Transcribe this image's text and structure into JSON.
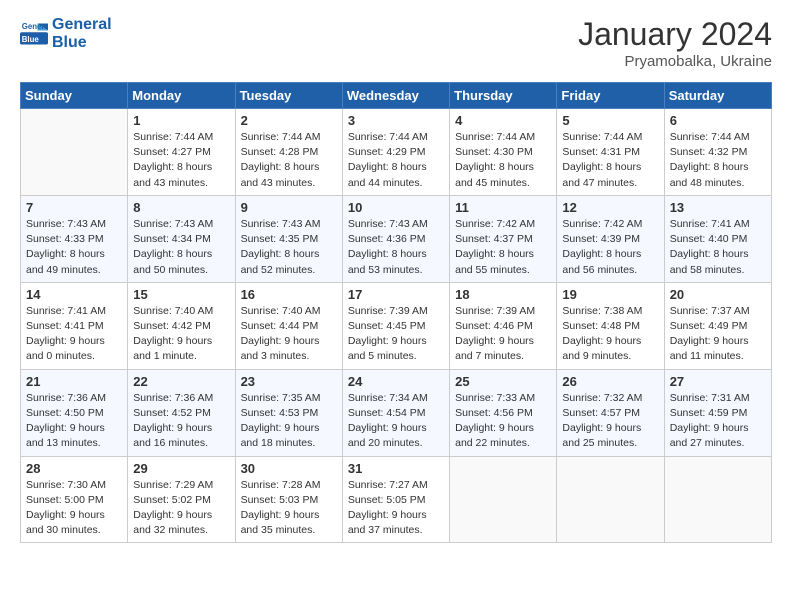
{
  "logo": {
    "line1": "General",
    "line2": "Blue"
  },
  "title": "January 2024",
  "location": "Pryamobalka, Ukraine",
  "days_of_week": [
    "Sunday",
    "Monday",
    "Tuesday",
    "Wednesday",
    "Thursday",
    "Friday",
    "Saturday"
  ],
  "weeks": [
    [
      {
        "day": "",
        "info": ""
      },
      {
        "day": "1",
        "info": "Sunrise: 7:44 AM\nSunset: 4:27 PM\nDaylight: 8 hours\nand 43 minutes."
      },
      {
        "day": "2",
        "info": "Sunrise: 7:44 AM\nSunset: 4:28 PM\nDaylight: 8 hours\nand 43 minutes."
      },
      {
        "day": "3",
        "info": "Sunrise: 7:44 AM\nSunset: 4:29 PM\nDaylight: 8 hours\nand 44 minutes."
      },
      {
        "day": "4",
        "info": "Sunrise: 7:44 AM\nSunset: 4:30 PM\nDaylight: 8 hours\nand 45 minutes."
      },
      {
        "day": "5",
        "info": "Sunrise: 7:44 AM\nSunset: 4:31 PM\nDaylight: 8 hours\nand 47 minutes."
      },
      {
        "day": "6",
        "info": "Sunrise: 7:44 AM\nSunset: 4:32 PM\nDaylight: 8 hours\nand 48 minutes."
      }
    ],
    [
      {
        "day": "7",
        "info": "Sunrise: 7:43 AM\nSunset: 4:33 PM\nDaylight: 8 hours\nand 49 minutes."
      },
      {
        "day": "8",
        "info": "Sunrise: 7:43 AM\nSunset: 4:34 PM\nDaylight: 8 hours\nand 50 minutes."
      },
      {
        "day": "9",
        "info": "Sunrise: 7:43 AM\nSunset: 4:35 PM\nDaylight: 8 hours\nand 52 minutes."
      },
      {
        "day": "10",
        "info": "Sunrise: 7:43 AM\nSunset: 4:36 PM\nDaylight: 8 hours\nand 53 minutes."
      },
      {
        "day": "11",
        "info": "Sunrise: 7:42 AM\nSunset: 4:37 PM\nDaylight: 8 hours\nand 55 minutes."
      },
      {
        "day": "12",
        "info": "Sunrise: 7:42 AM\nSunset: 4:39 PM\nDaylight: 8 hours\nand 56 minutes."
      },
      {
        "day": "13",
        "info": "Sunrise: 7:41 AM\nSunset: 4:40 PM\nDaylight: 8 hours\nand 58 minutes."
      }
    ],
    [
      {
        "day": "14",
        "info": "Sunrise: 7:41 AM\nSunset: 4:41 PM\nDaylight: 9 hours\nand 0 minutes."
      },
      {
        "day": "15",
        "info": "Sunrise: 7:40 AM\nSunset: 4:42 PM\nDaylight: 9 hours\nand 1 minute."
      },
      {
        "day": "16",
        "info": "Sunrise: 7:40 AM\nSunset: 4:44 PM\nDaylight: 9 hours\nand 3 minutes."
      },
      {
        "day": "17",
        "info": "Sunrise: 7:39 AM\nSunset: 4:45 PM\nDaylight: 9 hours\nand 5 minutes."
      },
      {
        "day": "18",
        "info": "Sunrise: 7:39 AM\nSunset: 4:46 PM\nDaylight: 9 hours\nand 7 minutes."
      },
      {
        "day": "19",
        "info": "Sunrise: 7:38 AM\nSunset: 4:48 PM\nDaylight: 9 hours\nand 9 minutes."
      },
      {
        "day": "20",
        "info": "Sunrise: 7:37 AM\nSunset: 4:49 PM\nDaylight: 9 hours\nand 11 minutes."
      }
    ],
    [
      {
        "day": "21",
        "info": "Sunrise: 7:36 AM\nSunset: 4:50 PM\nDaylight: 9 hours\nand 13 minutes."
      },
      {
        "day": "22",
        "info": "Sunrise: 7:36 AM\nSunset: 4:52 PM\nDaylight: 9 hours\nand 16 minutes."
      },
      {
        "day": "23",
        "info": "Sunrise: 7:35 AM\nSunset: 4:53 PM\nDaylight: 9 hours\nand 18 minutes."
      },
      {
        "day": "24",
        "info": "Sunrise: 7:34 AM\nSunset: 4:54 PM\nDaylight: 9 hours\nand 20 minutes."
      },
      {
        "day": "25",
        "info": "Sunrise: 7:33 AM\nSunset: 4:56 PM\nDaylight: 9 hours\nand 22 minutes."
      },
      {
        "day": "26",
        "info": "Sunrise: 7:32 AM\nSunset: 4:57 PM\nDaylight: 9 hours\nand 25 minutes."
      },
      {
        "day": "27",
        "info": "Sunrise: 7:31 AM\nSunset: 4:59 PM\nDaylight: 9 hours\nand 27 minutes."
      }
    ],
    [
      {
        "day": "28",
        "info": "Sunrise: 7:30 AM\nSunset: 5:00 PM\nDaylight: 9 hours\nand 30 minutes."
      },
      {
        "day": "29",
        "info": "Sunrise: 7:29 AM\nSunset: 5:02 PM\nDaylight: 9 hours\nand 32 minutes."
      },
      {
        "day": "30",
        "info": "Sunrise: 7:28 AM\nSunset: 5:03 PM\nDaylight: 9 hours\nand 35 minutes."
      },
      {
        "day": "31",
        "info": "Sunrise: 7:27 AM\nSunset: 5:05 PM\nDaylight: 9 hours\nand 37 minutes."
      },
      {
        "day": "",
        "info": ""
      },
      {
        "day": "",
        "info": ""
      },
      {
        "day": "",
        "info": ""
      }
    ]
  ]
}
